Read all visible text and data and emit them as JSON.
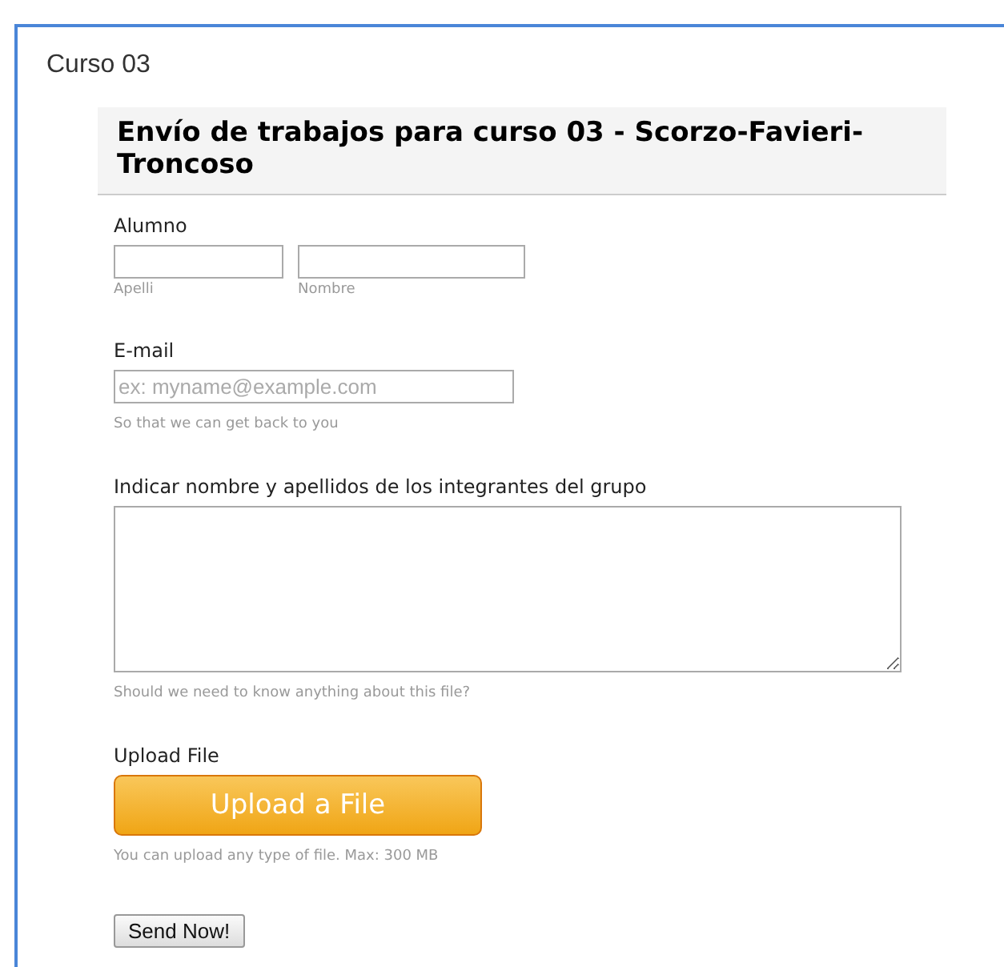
{
  "page_title": "Curso 03",
  "form": {
    "title": "Envío de trabajos para curso 03 - Scorzo-Favieri-Troncoso",
    "fields": [
      {
        "kind": "name",
        "label": "Alumno",
        "parts": [
          {
            "sublabel": "Apelli"
          },
          {
            "sublabel": "Nombre"
          }
        ]
      },
      {
        "kind": "email",
        "label": "E-mail",
        "placeholder": "ex: myname@example.com",
        "hint": "So that we can get back to you"
      },
      {
        "kind": "textarea",
        "label": "Indicar nombre y apellidos de los integrantes del grupo",
        "hint": "Should we need to know anything about this file?"
      },
      {
        "kind": "upload",
        "label": "Upload File",
        "button": "Upload a File",
        "hint": "You can upload any type of file. Max: 300 MB"
      }
    ],
    "submit": "Send Now!"
  }
}
